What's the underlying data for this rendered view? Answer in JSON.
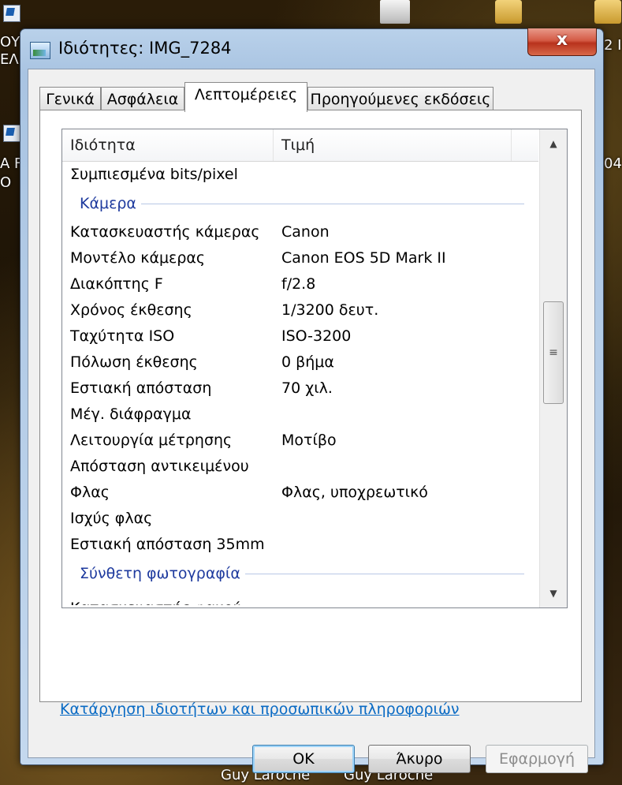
{
  "desktop": {
    "left_fragments": [
      "ΟΥ",
      "ΕΛ",
      "Α F",
      "Ο"
    ],
    "right_fragments": [
      "2 Ι",
      "04"
    ],
    "labels": [
      "Guy Laroche",
      "Guy Laroche"
    ]
  },
  "window": {
    "title": "Ιδιότητες: IMG_7284",
    "close_label": "x"
  },
  "tabs": [
    {
      "label": "Γενικά"
    },
    {
      "label": "Ασφάλεια"
    },
    {
      "label": "Λεπτομέρειες"
    },
    {
      "label": "Προηγούμενες εκδόσεις"
    }
  ],
  "active_tab": "Λεπτομέρειες",
  "list": {
    "columns": [
      "Ιδιότητα",
      "Τιμή"
    ],
    "top_row": {
      "name": "Συμπιεσμένα bits/pixel",
      "value": ""
    },
    "groups": [
      {
        "title": "Κάμερα",
        "rows": [
          {
            "name": "Κατασκευαστής κάμερας",
            "value": "Canon"
          },
          {
            "name": "Μοντέλο κάμερας",
            "value": "Canon EOS 5D Mark II"
          },
          {
            "name": "Διακόπτης F",
            "value": "f/2.8"
          },
          {
            "name": "Χρόνος έκθεσης",
            "value": "1/3200 δευτ."
          },
          {
            "name": "Ταχύτητα ISO",
            "value": "ISO-3200"
          },
          {
            "name": "Πόλωση έκθεσης",
            "value": "0 βήμα"
          },
          {
            "name": "Εστιακή απόσταση",
            "value": "70 χιλ."
          },
          {
            "name": "Μέγ. διάφραγμα",
            "value": ""
          },
          {
            "name": "Λειτουργία μέτρησης",
            "value": "Μοτίβο"
          },
          {
            "name": "Απόσταση αντικειμένου",
            "value": ""
          },
          {
            "name": "Φλας",
            "value": "Φλας, υποχρεωτικό"
          },
          {
            "name": "Ισχύς φλας",
            "value": ""
          },
          {
            "name": "Εστιακή απόσταση 35mm",
            "value": ""
          }
        ]
      },
      {
        "title": "Σύνθετη φωτογραφία",
        "rows": [
          {
            "name": "Κατασκευαστής φακού",
            "value": ""
          }
        ]
      }
    ],
    "scroll_position": 0.45
  },
  "remove_link": "Κατάργηση ιδιοτήτων και προσωπικών πληροφοριών",
  "buttons": {
    "ok": "OK",
    "cancel": "Άκυρο",
    "apply": "Εφαρμογή"
  },
  "icons": {
    "title_icon": "image-file-icon",
    "scroll_up": "arrow-up-icon",
    "scroll_down": "arrow-down-icon",
    "thumb_grip": "grip-icon"
  }
}
